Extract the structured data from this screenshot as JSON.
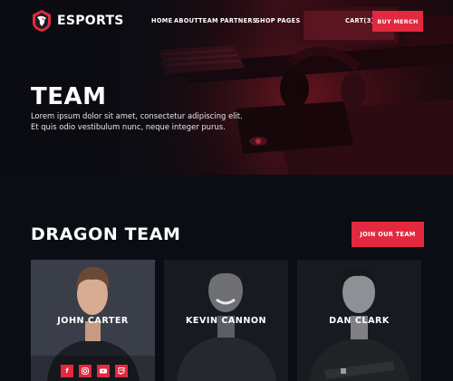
{
  "brand": {
    "name": "ESPORTS",
    "accent": "#e2293f"
  },
  "nav": {
    "links": [
      "HOME",
      "ABOUT",
      "TEAM",
      "PARTNERS",
      "SHOP",
      "PAGES"
    ],
    "cart": "CART(3)",
    "cta": "BUY MERCH"
  },
  "hero": {
    "title": "TEAM",
    "text": "Lorem ipsum dolor sit amet, consectetur adipiscing elit. Et quis odio vestibulum nunc, neque integer purus."
  },
  "section": {
    "title": "DRAGON TEAM",
    "cta": "JOIN OUR TEAM"
  },
  "team": [
    {
      "name": "JOHN CARTER",
      "socials": [
        "facebook-icon",
        "instagram-icon",
        "youtube-icon",
        "twitch-icon"
      ]
    },
    {
      "name": "KEVIN CANNON"
    },
    {
      "name": "DAN CLARK"
    }
  ]
}
